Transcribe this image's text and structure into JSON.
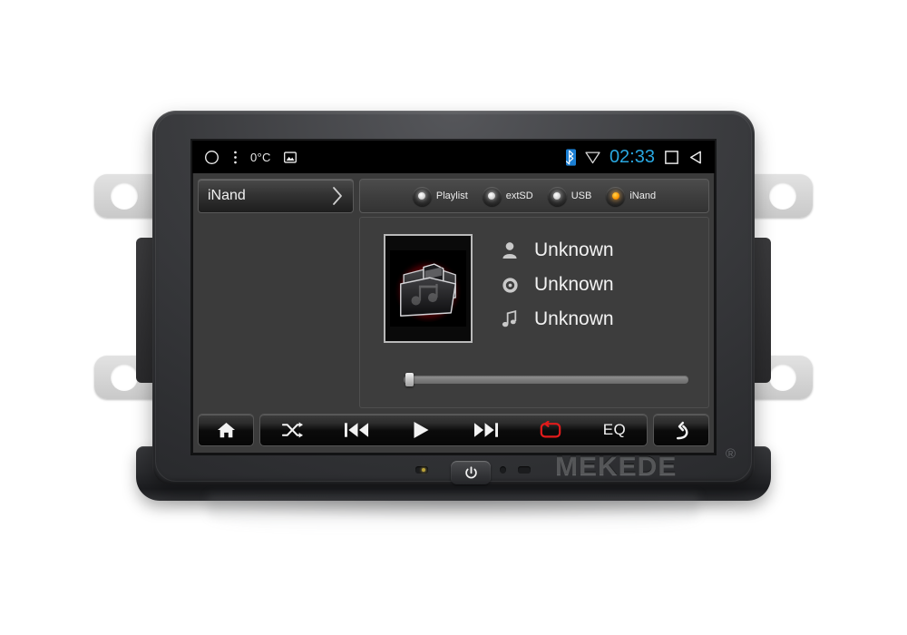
{
  "device": {
    "brand": "MEKEDE",
    "trademark": "®",
    "power_button_icon": "power-icon"
  },
  "status_bar": {
    "home_icon": "circle-home-icon",
    "menu_icon": "overflow-menu-icon",
    "temperature": "0°C",
    "screenshot_icon": "image-icon",
    "bluetooth_icon": "bluetooth-icon",
    "wifi_icon": "wifi-signal-icon",
    "clock": "02:33",
    "recents_icon": "square-recents-icon",
    "back_icon": "back-triangle-icon",
    "clock_color": "#29a7e0",
    "bluetooth_color": "#2196f3"
  },
  "path_chip": {
    "label": "iNand",
    "chevron_icon": "chevron-right-icon"
  },
  "sources": [
    {
      "label": "Playlist",
      "active": false
    },
    {
      "label": "extSD",
      "active": false
    },
    {
      "label": "USB",
      "active": false
    },
    {
      "label": "iNand",
      "active": true
    }
  ],
  "player": {
    "album_art_icon": "music-folder-icon",
    "metadata": [
      {
        "icon": "artist-person-icon",
        "value": "Unknown"
      },
      {
        "icon": "album-disc-icon",
        "value": "Unknown"
      },
      {
        "icon": "track-note-icon",
        "value": "Unknown"
      }
    ],
    "progress_percent": 0
  },
  "controls": {
    "home": {
      "name": "home-button",
      "icon": "home-icon"
    },
    "shuffle": {
      "name": "shuffle-button",
      "icon": "shuffle-icon"
    },
    "prev": {
      "name": "previous-button",
      "icon": "previous-track-icon"
    },
    "play": {
      "name": "play-button",
      "icon": "play-icon"
    },
    "next": {
      "name": "next-button",
      "icon": "next-track-icon"
    },
    "repeat": {
      "name": "repeat-button",
      "icon": "repeat-icon",
      "color": "#e01b1b",
      "active": true
    },
    "eq": {
      "name": "eq-button",
      "label": "EQ"
    },
    "back": {
      "name": "back-button",
      "icon": "return-arrow-icon"
    }
  },
  "colors": {
    "screen_bg": "#3b3b3b",
    "status_bar_bg": "#000000",
    "accent_led": "#ff9b05",
    "repeat_red": "#e01b1b",
    "bezel": "#2c2d30"
  }
}
